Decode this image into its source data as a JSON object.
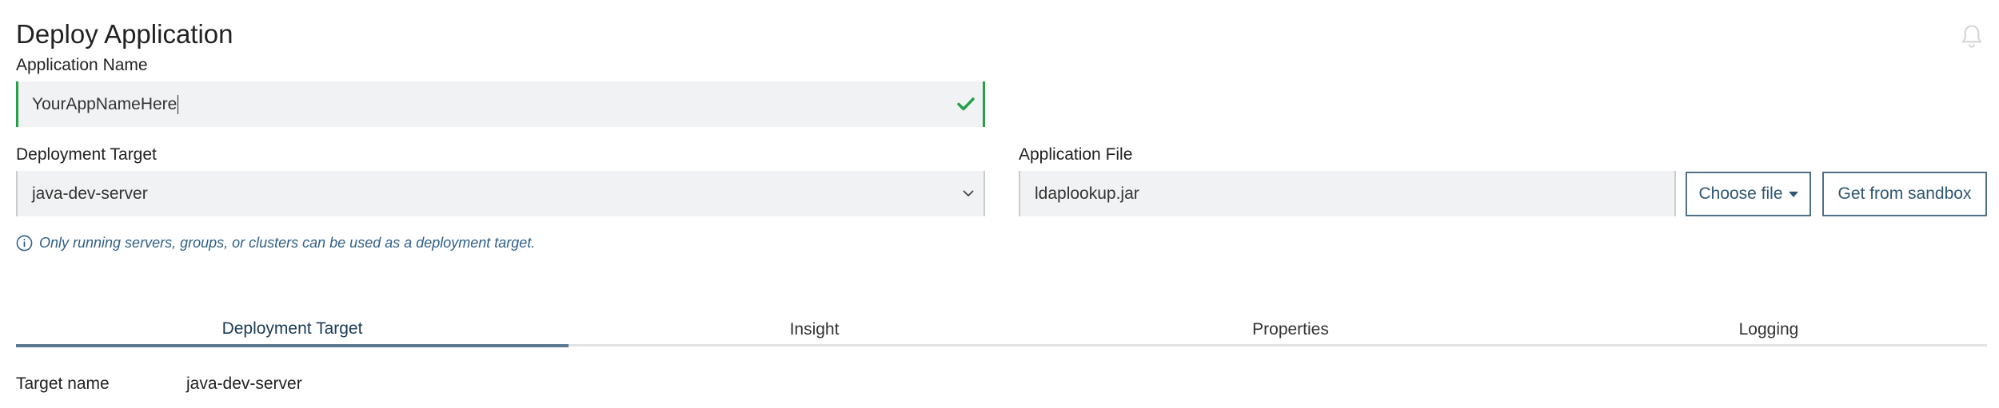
{
  "page": {
    "title": "Deploy Application"
  },
  "app_name": {
    "label": "Application Name",
    "value": "YourAppNameHere",
    "valid": true
  },
  "deployment_target": {
    "label": "Deployment Target",
    "selected": "java-dev-server",
    "hint": "Only running servers, groups, or clusters can be used as a deployment target."
  },
  "application_file": {
    "label": "Application File",
    "value": "ldaplookup.jar",
    "choose_file_label": "Choose file",
    "sandbox_label": "Get from sandbox"
  },
  "tabs": [
    {
      "label": "Deployment Target",
      "active": true
    },
    {
      "label": "Insight",
      "active": false
    },
    {
      "label": "Properties",
      "active": false
    },
    {
      "label": "Logging",
      "active": false
    }
  ],
  "details": {
    "target_name_label": "Target name",
    "target_name_value": "java-dev-server"
  },
  "colors": {
    "valid_green": "#24a148",
    "accent_blue": "#2f5672",
    "hint_blue": "#2f5f86"
  },
  "icons": {
    "bell": "bell-icon",
    "check": "checkmark-icon",
    "chevron": "chevron-down-icon",
    "info": "info-circle-icon",
    "caret": "caret-down-icon"
  }
}
